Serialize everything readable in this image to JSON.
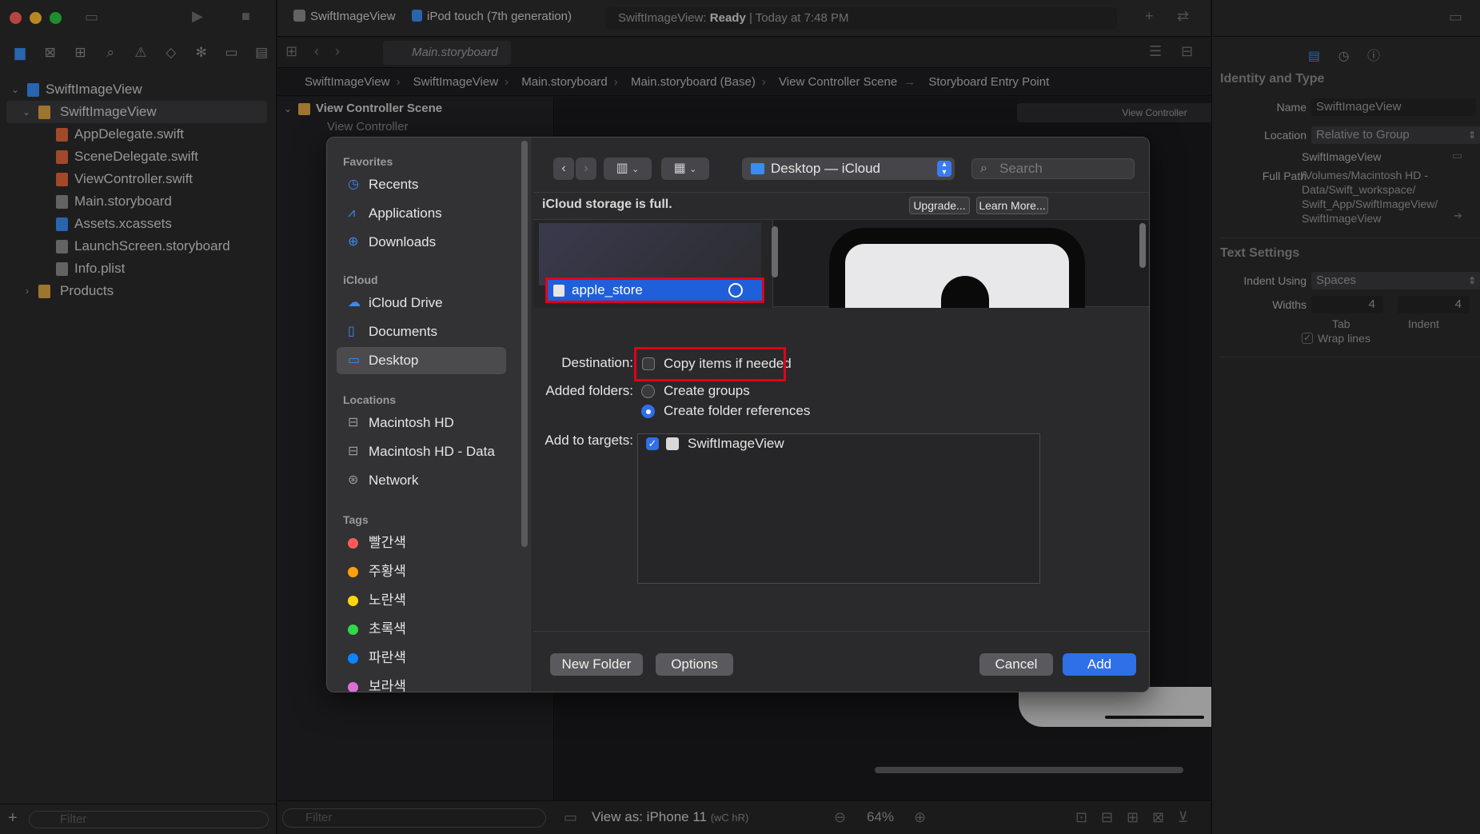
{
  "project_navigator": {
    "items": [
      {
        "label": "SwiftImageView",
        "level": 0,
        "kind": "project"
      },
      {
        "label": "SwiftImageView",
        "level": 1,
        "kind": "folder"
      },
      {
        "label": "AppDelegate.swift",
        "level": 2,
        "kind": "swift"
      },
      {
        "label": "SceneDelegate.swift",
        "level": 2,
        "kind": "swift"
      },
      {
        "label": "ViewController.swift",
        "level": 2,
        "kind": "swift"
      },
      {
        "label": "Main.storyboard",
        "level": 2,
        "kind": "storyboard"
      },
      {
        "label": "Assets.xcassets",
        "level": 2,
        "kind": "assets"
      },
      {
        "label": "LaunchScreen.storyboard",
        "level": 2,
        "kind": "storyboard"
      },
      {
        "label": "Info.plist",
        "level": 2,
        "kind": "plist"
      },
      {
        "label": "Products",
        "level": 1,
        "kind": "folder"
      }
    ],
    "filter_placeholder": "Filter"
  },
  "toolbar": {
    "scheme": "SwiftImageView",
    "device": "iPod touch (7th generation)",
    "status_prefix": "SwiftImageView: ",
    "status_state": "Ready",
    "status_suffix": " | Today at 7:48 PM"
  },
  "editor": {
    "tab": "Main.storyboard",
    "breadcrumb": [
      "SwiftImageView",
      "SwiftImageView",
      "Main.storyboard",
      "Main.storyboard (Base)",
      "View Controller Scene",
      "Storyboard Entry Point"
    ],
    "outline_scene": "View Controller Scene",
    "outline_vc": "View Controller",
    "canvas_label": "View Controller",
    "outline_filter": "Filter",
    "view_as": "View as: iPhone 11",
    "view_as_traits": "(wC hR)",
    "zoom": "64%"
  },
  "inspector": {
    "identity_title": "Identity and Type",
    "name_label": "Name",
    "name_value": "SwiftImageView",
    "location_label": "Location",
    "location_value": "Relative to Group",
    "location_file": "SwiftImageView",
    "full_path_label": "Full Path",
    "full_path_lines": [
      "/Volumes/Macintosh HD -",
      "Data/Swift_workspace/",
      "Swift_App/SwiftImageView/",
      "SwiftImageView"
    ],
    "text_settings_title": "Text Settings",
    "indent_using_label": "Indent Using",
    "indent_using_value": "Spaces",
    "widths_label": "Widths",
    "tab_value": "4",
    "indent_value": "4",
    "tab_label": "Tab",
    "indent_label": "Indent",
    "wrap_lines": "Wrap lines"
  },
  "dialog": {
    "sidebar": {
      "favorites_header": "Favorites",
      "favorites": [
        "Recents",
        "Applications",
        "Downloads"
      ],
      "icloud_header": "iCloud",
      "icloud": [
        "iCloud Drive",
        "Documents",
        "Desktop"
      ],
      "locations_header": "Locations",
      "locations": [
        "Macintosh HD",
        "Macintosh HD - Data",
        "Network"
      ],
      "tags_header": "Tags",
      "tags": [
        {
          "label": "빨간색",
          "color": "#ff5a5a"
        },
        {
          "label": "주황색",
          "color": "#ff9f0a"
        },
        {
          "label": "노란색",
          "color": "#ffd60a"
        },
        {
          "label": "초록색",
          "color": "#32d74b"
        },
        {
          "label": "파란색",
          "color": "#0a84ff"
        },
        {
          "label": "보라색",
          "color": "#da70d6"
        }
      ],
      "selected": "Desktop"
    },
    "location_popup": "Desktop — iCloud",
    "search_placeholder": "Search",
    "icloud_message": "iCloud storage is full.",
    "upgrade_label": "Upgrade...",
    "learn_more_label": "Learn More...",
    "selected_file": "apple_store",
    "destination_label": "Destination:",
    "copy_items_label": "Copy items if needed",
    "copy_items_checked": false,
    "added_folders_label": "Added folders:",
    "create_groups_label": "Create groups",
    "create_folder_refs_label": "Create folder references",
    "added_folders_selected": "Create folder references",
    "add_to_targets_label": "Add to targets:",
    "target_name": "SwiftImageView",
    "target_checked": true,
    "new_folder_label": "New Folder",
    "options_label": "Options",
    "cancel_label": "Cancel",
    "add_label": "Add"
  },
  "colors": {
    "accent": "#2f6fe8",
    "highlight_annotation": "#e0001a"
  }
}
